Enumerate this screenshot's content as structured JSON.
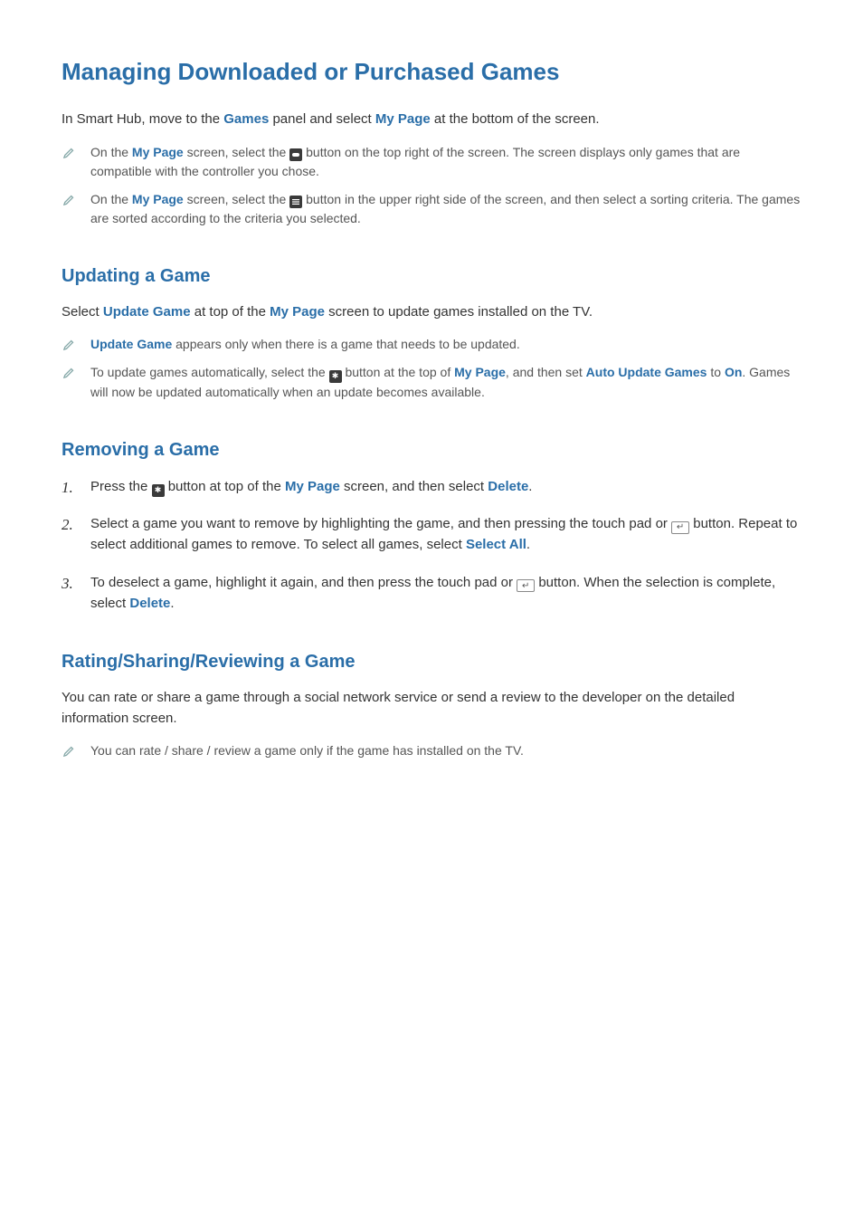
{
  "title": "Managing Downloaded or Purchased Games",
  "intro": {
    "pre": "In Smart Hub, move to the ",
    "games": "Games",
    "mid": " panel and select ",
    "mypage": "My Page",
    "post": " at the bottom of the screen."
  },
  "notes1": [
    {
      "pre": "On the ",
      "mypage": "My Page",
      "mid": " screen, select the ",
      "post": " button on the top right of the screen. The screen displays only games that are compatible with the controller you chose."
    },
    {
      "pre": "On the ",
      "mypage": "My Page",
      "mid": " screen, select the ",
      "post": " button in the upper right side of the screen, and then select a sorting criteria. The games are sorted according to the criteria you selected."
    }
  ],
  "updating": {
    "heading": "Updating a Game",
    "line": {
      "pre": "Select ",
      "updategame": "Update Game",
      "mid": " at top of the ",
      "mypage": "My Page",
      "post": " screen to update games installed on the TV."
    },
    "n1": {
      "updategame": "Update Game",
      "post": " appears only when there is a game that needs to be updated."
    },
    "n2": {
      "pre": "To update games automatically, select the ",
      "mid": " button at the top of ",
      "mypage": "My Page",
      "mid2": ", and then set ",
      "auto": "Auto Update Games",
      "to": " to ",
      "on": "On",
      "post": ". Games will now be updated automatically when an update becomes available."
    }
  },
  "removing": {
    "heading": "Removing a Game",
    "steps": [
      {
        "num": "1.",
        "pre": "Press the ",
        "mid": " button at top of the ",
        "mypage": "My Page",
        "mid2": " screen, and then select ",
        "delete": "Delete",
        "post": "."
      },
      {
        "num": "2.",
        "pre": "Select a game you want to remove by highlighting the game, and then pressing the touch pad or ",
        "mid": " button. Repeat to select additional games to remove. To select all games, select ",
        "selectall": "Select All",
        "post": "."
      },
      {
        "num": "3.",
        "pre": "To deselect a game, highlight it again, and then press the touch pad or ",
        "mid": " button. When the selection is complete, select ",
        "delete": "Delete",
        "post": "."
      }
    ]
  },
  "rating": {
    "heading": "Rating/Sharing/Reviewing a Game",
    "line": "You can rate or share a game through a social network service or send a review to the developer on the detailed information screen.",
    "note": "You can rate / share / review a game only if the game has installed on the TV."
  }
}
